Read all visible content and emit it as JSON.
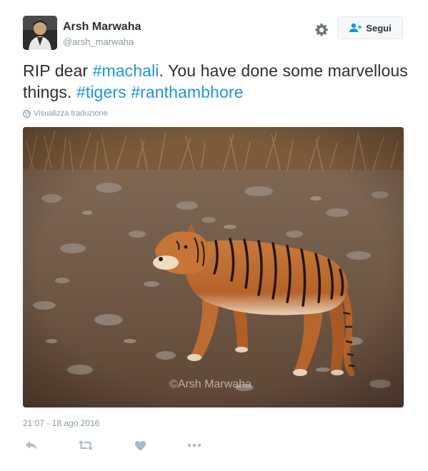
{
  "author": {
    "name": "Arsh Marwaha",
    "handle": "@arsh_marwaha"
  },
  "header": {
    "follow_label": "Segui",
    "settings_icon": "gear-icon",
    "follow_icon": "person-add-icon"
  },
  "tweet": {
    "text_parts": [
      "RIP dear ",
      "#machali",
      ". You have done some marvellous things. ",
      "#tigers",
      " ",
      "#ranthambhore"
    ],
    "translate_label": "Visualizza traduzione",
    "translate_icon": "globe-icon",
    "photo_watermark": "©Arsh Marwaha",
    "timestamp": "21:07 - 18 ago 2016"
  },
  "actions": {
    "icons": [
      "reply-icon",
      "retweet-icon",
      "like-icon",
      "more-icon"
    ]
  },
  "colors": {
    "link": "#1b95e0",
    "secondary_text": "#8899a6",
    "primary_text": "#292f33"
  }
}
